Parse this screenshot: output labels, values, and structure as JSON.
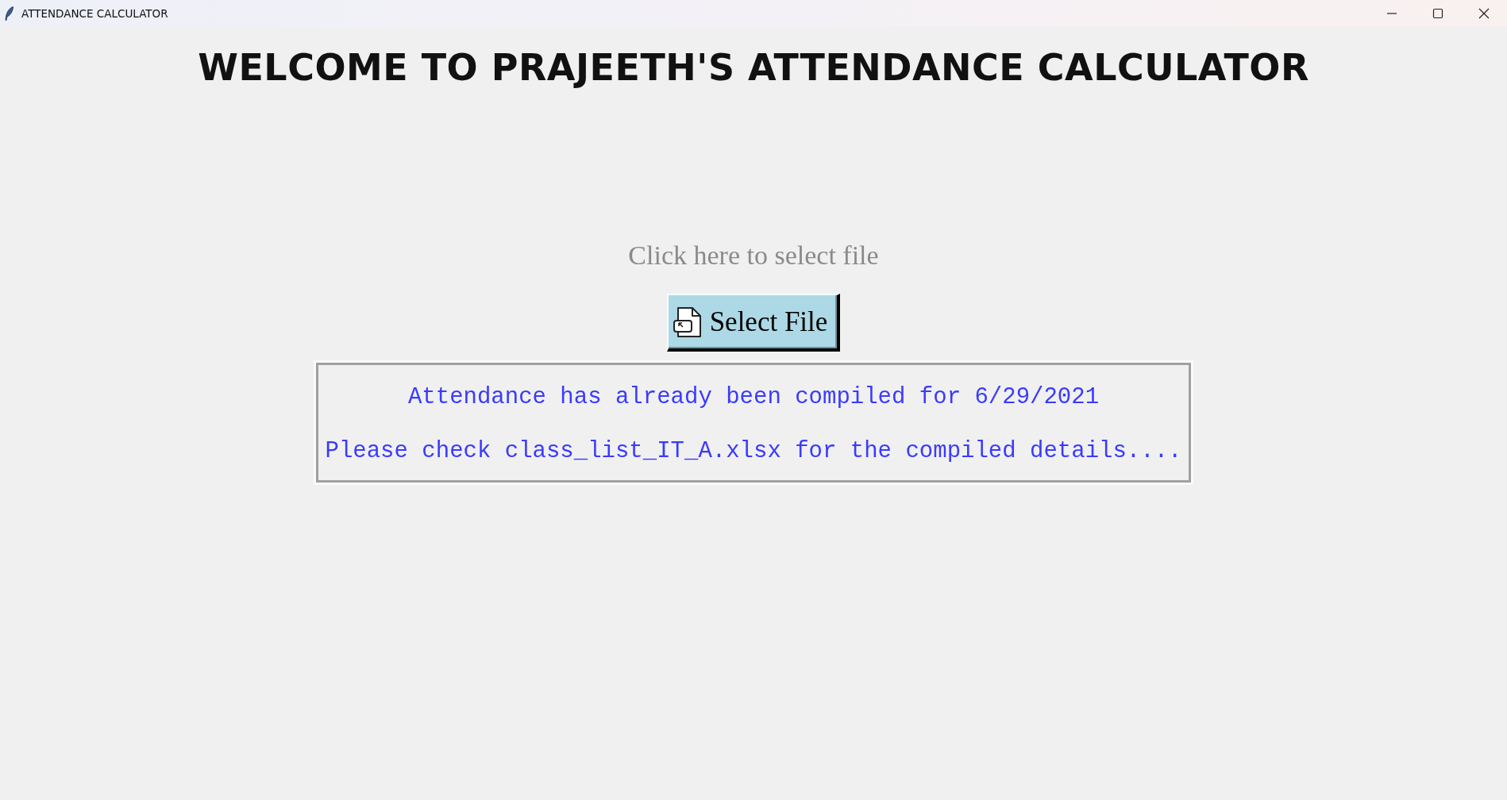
{
  "window": {
    "title": "ATTENDANCE CALCULATOR"
  },
  "heading": "WELCOME TO PRAJEETH'S ATTENDANCE CALCULATOR",
  "prompt": "Click here to select file",
  "select_button": {
    "label": "Select File"
  },
  "message_box": {
    "lines": [
      "Attendance has already been compiled for 6/29/2021",
      "Please check class_list_IT_A.xlsx for the compiled details...."
    ]
  }
}
